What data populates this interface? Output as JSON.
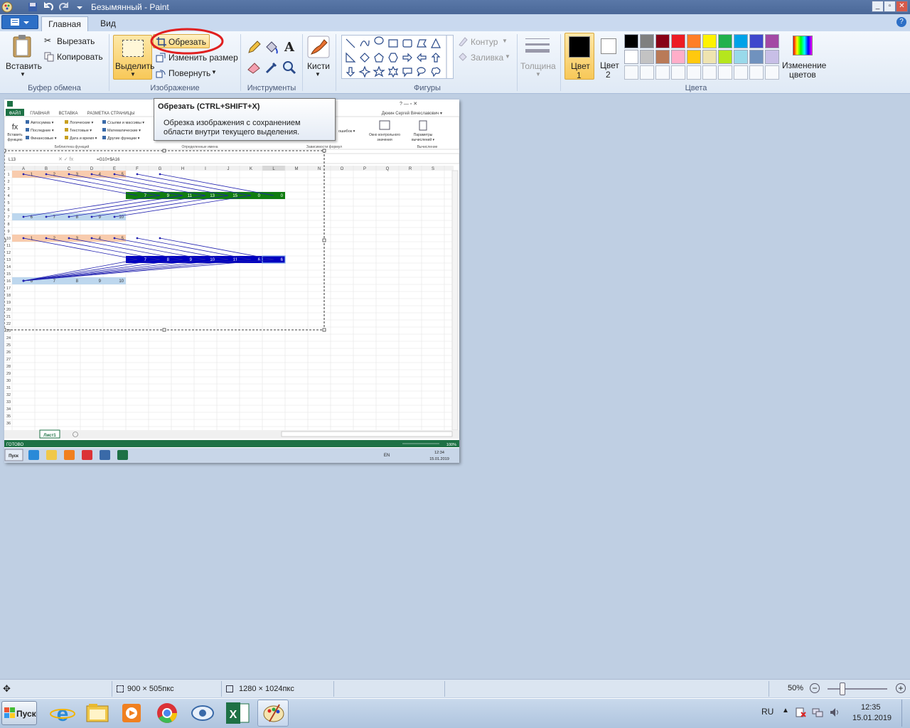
{
  "window": {
    "title": "Безымянный - Paint"
  },
  "tabs": {
    "home": "Главная",
    "view": "Вид"
  },
  "clipboard": {
    "paste": "Вставить",
    "cut": "Вырезать",
    "copy": "Копировать",
    "group": "Буфер обмена"
  },
  "image": {
    "select": "Выделить",
    "crop": "Обрезать",
    "resize": "Изменить размер",
    "rotate": "Повернуть",
    "group": "Изображение"
  },
  "tools": {
    "group": "Инструменты"
  },
  "brushes": {
    "label": "Кисти"
  },
  "shapes": {
    "outline": "Контур",
    "fill": "Заливка",
    "group": "Фигуры"
  },
  "size": {
    "label": "Толщина"
  },
  "colors": {
    "color1": "Цвет\n1",
    "color2": "Цвет\n2",
    "color1_label_a": "Цвет",
    "color1_label_b": "1",
    "color2_label_a": "Цвет",
    "color2_label_b": "2",
    "edit": "Изменение",
    "edit2": "цветов",
    "group": "Цвета",
    "palette": [
      "#000000",
      "#7f7f7f",
      "#880015",
      "#ed1c24",
      "#ff7f27",
      "#fff200",
      "#22b14c",
      "#00a2e8",
      "#3f48cc",
      "#a349a4",
      "#ffffff",
      "#c3c3c3",
      "#b97a57",
      "#ffaec9",
      "#ffc90e",
      "#efe4b0",
      "#b5e61d",
      "#99d9ea",
      "#7092be",
      "#c8bfe7"
    ]
  },
  "tooltip": {
    "title": "Обрезать (CTRL+SHIFT+X)",
    "line1": "Обрезка изображения с сохранением",
    "line2": "области внутри текущего выделения."
  },
  "excel": {
    "tabs": [
      "ФАЙЛ",
      "ГЛАВНАЯ",
      "ВСТАВКА",
      "РАЗМЕТКА СТРАНИЦЫ"
    ],
    "user": "Дюкин Сергей Вячеславович",
    "insert_fn": "Вставить функцию",
    "fn_items": [
      "Автосумма",
      "Последние",
      "Финансовые",
      "Логические",
      "Текстовые",
      "Дата и время",
      "Ссылки и массивы",
      "Математические",
      "Другие функции"
    ],
    "lib": "Библиотека функций",
    "names": "Определенные имена",
    "deps": "Зависимости формул",
    "calc": "Вычисление",
    "errors": "ошибок",
    "watch": "Окно контрольного значения",
    "calc_params": "Параметры вычислений",
    "namebox": "L13",
    "formula": "=G10+$A16",
    "cols": [
      "A",
      "B",
      "C",
      "D",
      "E",
      "F",
      "G",
      "H",
      "I",
      "J",
      "K",
      "L",
      "M",
      "N",
      "O",
      "P",
      "Q",
      "R",
      "S"
    ],
    "row1": [
      "1",
      "2",
      "3",
      "4",
      "5"
    ],
    "row4": [
      "7",
      "9",
      "11",
      "13",
      "15",
      "0",
      "0"
    ],
    "row7": [
      "6",
      "7",
      "8",
      "9",
      "10"
    ],
    "row13": [
      "7",
      "8",
      "9",
      "10",
      "11",
      "6",
      "6"
    ],
    "row16": [
      "6",
      "7",
      "8",
      "9",
      "10"
    ],
    "sheet": "Лист1",
    "status": "ГОТОВО",
    "zoom": "100%",
    "lang": "EN",
    "time": "12:34",
    "date": "15.01.2019",
    "start": "Пуск"
  },
  "status": {
    "selection": "900 × 505пкс",
    "size": "1280 × 1024пкс",
    "zoom": "50%"
  },
  "taskbar": {
    "start": "Пуск",
    "lang": "RU",
    "time": "12:35",
    "date": "15.01.2019"
  }
}
